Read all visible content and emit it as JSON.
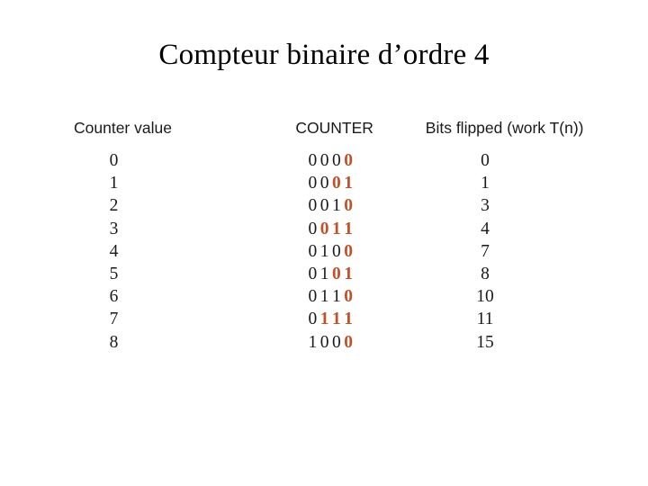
{
  "slide": {
    "title": "Compteur binaire d’ordre 4",
    "background_color": "#ffffff",
    "text_color": "#1a1a1a",
    "highlight_color": "#c0522b"
  },
  "table": {
    "headers": {
      "counter_value": "Counter value",
      "counter": "COUNTER",
      "bits_flipped": "Bits flipped (work T(n))"
    },
    "rows": [
      {
        "counter_value": "0",
        "counter_bits": [
          {
            "bit": "0",
            "flipped": false
          },
          {
            "bit": "0",
            "flipped": false
          },
          {
            "bit": "0",
            "flipped": false
          },
          {
            "bit": "0",
            "flipped": true
          }
        ],
        "bits_flipped": "0"
      },
      {
        "counter_value": "1",
        "counter_bits": [
          {
            "bit": "0",
            "flipped": false
          },
          {
            "bit": "0",
            "flipped": false
          },
          {
            "bit": "0",
            "flipped": true
          },
          {
            "bit": "1",
            "flipped": true
          }
        ],
        "bits_flipped": "1"
      },
      {
        "counter_value": "2",
        "counter_bits": [
          {
            "bit": "0",
            "flipped": false
          },
          {
            "bit": "0",
            "flipped": false
          },
          {
            "bit": "1",
            "flipped": false
          },
          {
            "bit": "0",
            "flipped": true
          }
        ],
        "bits_flipped": "3"
      },
      {
        "counter_value": "3",
        "counter_bits": [
          {
            "bit": "0",
            "flipped": false
          },
          {
            "bit": "0",
            "flipped": true
          },
          {
            "bit": "1",
            "flipped": true
          },
          {
            "bit": "1",
            "flipped": true
          }
        ],
        "bits_flipped": "4"
      },
      {
        "counter_value": "4",
        "counter_bits": [
          {
            "bit": "0",
            "flipped": false
          },
          {
            "bit": "1",
            "flipped": false
          },
          {
            "bit": "0",
            "flipped": false
          },
          {
            "bit": "0",
            "flipped": true
          }
        ],
        "bits_flipped": "7"
      },
      {
        "counter_value": "5",
        "counter_bits": [
          {
            "bit": "0",
            "flipped": false
          },
          {
            "bit": "1",
            "flipped": false
          },
          {
            "bit": "0",
            "flipped": true
          },
          {
            "bit": "1",
            "flipped": true
          }
        ],
        "bits_flipped": "8"
      },
      {
        "counter_value": "6",
        "counter_bits": [
          {
            "bit": "0",
            "flipped": false
          },
          {
            "bit": "1",
            "flipped": false
          },
          {
            "bit": "1",
            "flipped": false
          },
          {
            "bit": "0",
            "flipped": true
          }
        ],
        "bits_flipped": "10"
      },
      {
        "counter_value": "7",
        "counter_bits": [
          {
            "bit": "0",
            "flipped": false
          },
          {
            "bit": "1",
            "flipped": true
          },
          {
            "bit": "1",
            "flipped": true
          },
          {
            "bit": "1",
            "flipped": true
          }
        ],
        "bits_flipped": "11"
      },
      {
        "counter_value": "8",
        "counter_bits": [
          {
            "bit": "1",
            "flipped": false
          },
          {
            "bit": "0",
            "flipped": false
          },
          {
            "bit": "0",
            "flipped": false
          },
          {
            "bit": "0",
            "flipped": true
          }
        ],
        "bits_flipped": "15"
      }
    ]
  }
}
